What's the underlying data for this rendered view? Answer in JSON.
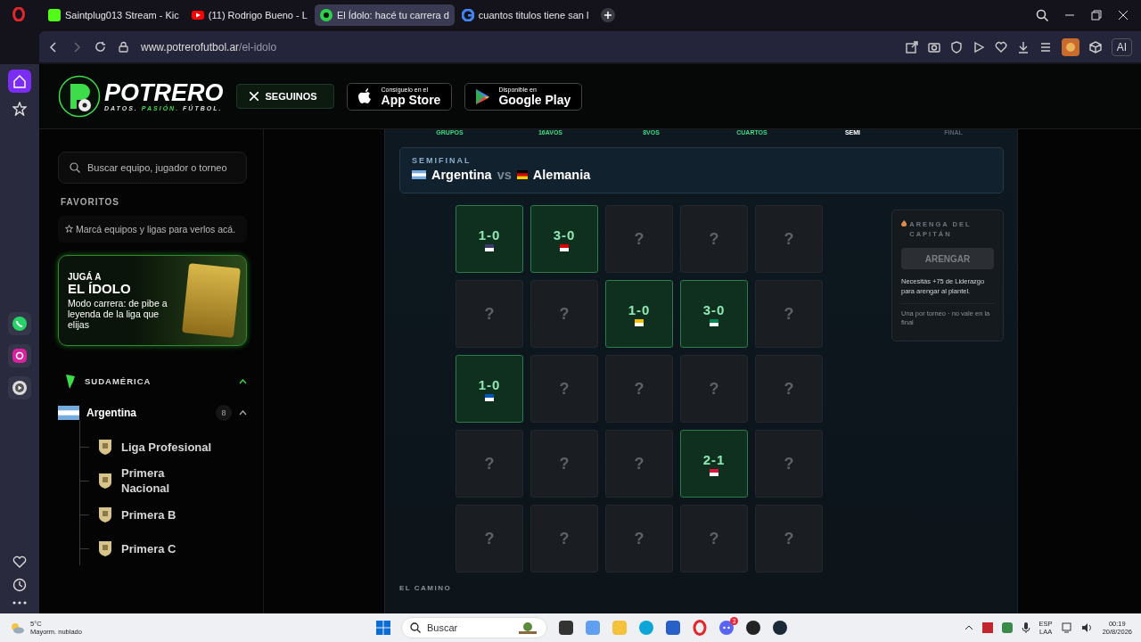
{
  "browser": {
    "tabs": [
      {
        "title": "Saintplug013 Stream - Kic",
        "selected": false
      },
      {
        "title": "(11) Rodrigo Bueno - L",
        "selected": false
      },
      {
        "title": "El Ídolo: hacé tu carrera d",
        "selected": true
      },
      {
        "title": "cuantos titulos tiene san l",
        "selected": false
      }
    ],
    "url_host": "www.potrerofutbol.ar",
    "url_path": "/el-idolo",
    "ai_label": "AI"
  },
  "header": {
    "logo_name": "POTRERO",
    "tagline": [
      {
        "text": "DATOS.",
        "accent": false
      },
      {
        "text": "PASIÓN.",
        "accent": true
      },
      {
        "text": "FÚTBOL.",
        "accent": false
      }
    ],
    "follow_button": "SEGUINOS",
    "stores": [
      {
        "kind": "apple",
        "small": "Consíguelo en el",
        "big": "App Store"
      },
      {
        "kind": "google",
        "small": "Disponible en",
        "big": "Google Play"
      }
    ]
  },
  "sidebar": {
    "search": {
      "placeholder": "Buscar equipo, jugador o torneo"
    },
    "favorites_title": "FAVORITOS",
    "favorites_hint": "Marcá equipos y ligas para verlos acá.",
    "promo": {
      "kicker": "JUGÁ A",
      "title": "EL ÍDOLO",
      "text": "Modo carrera: de pibe a leyenda de la liga que elijas"
    },
    "region": {
      "name": "SUDAMÉRICA",
      "expanded": true,
      "countries": [
        {
          "name": "Argentina",
          "count": "8",
          "expanded": true,
          "leagues": [
            {
              "name": "Liga Profesional"
            },
            {
              "name": "Primera Nacional"
            },
            {
              "name": "Primera B"
            },
            {
              "name": "Primera C"
            }
          ]
        }
      ]
    }
  },
  "game": {
    "stages": [
      {
        "label": "GRUPOS",
        "selected": false,
        "disabled": false
      },
      {
        "label": "16AVOS",
        "selected": false,
        "disabled": false
      },
      {
        "label": "8VOS",
        "selected": false,
        "disabled": false
      },
      {
        "label": "CUARTOS",
        "selected": false,
        "disabled": false
      },
      {
        "label": "SEMI",
        "selected": true,
        "disabled": false
      },
      {
        "label": "FINAL",
        "selected": false,
        "disabled": true
      }
    ],
    "round": "SEMIFINAL",
    "home": "Argentina",
    "vs": "vs",
    "away": "Alemania",
    "grid": [
      {
        "cells": [
          {
            "kind": "result",
            "score": "1-0",
            "color": "#3c3b6e"
          },
          {
            "kind": "result",
            "score": "3-0",
            "color": "#da0000"
          },
          {
            "kind": "unknown",
            "mark": "?"
          },
          {
            "kind": "unknown",
            "mark": "?"
          },
          {
            "kind": "unknown",
            "mark": "?"
          }
        ]
      },
      {
        "cells": [
          {
            "kind": "unknown",
            "mark": "?"
          },
          {
            "kind": "unknown",
            "mark": "?"
          },
          {
            "kind": "result",
            "score": "1-0",
            "color": "#f2c200"
          },
          {
            "kind": "result",
            "score": "3-0",
            "color": "#008751"
          },
          {
            "kind": "unknown",
            "mark": "?"
          }
        ]
      },
      {
        "cells": [
          {
            "kind": "result",
            "score": "1-0",
            "color": "#0057b7"
          },
          {
            "kind": "unknown",
            "mark": "?"
          },
          {
            "kind": "unknown",
            "mark": "?"
          },
          {
            "kind": "unknown",
            "mark": "?"
          },
          {
            "kind": "unknown",
            "mark": "?"
          }
        ]
      },
      {
        "cells": [
          {
            "kind": "unknown",
            "mark": "?"
          },
          {
            "kind": "unknown",
            "mark": "?"
          },
          {
            "kind": "unknown",
            "mark": "?"
          },
          {
            "kind": "result",
            "score": "2-1",
            "color": "#dc143c"
          },
          {
            "kind": "unknown",
            "mark": "?"
          }
        ]
      },
      {
        "cells": [
          {
            "kind": "unknown",
            "mark": "?"
          },
          {
            "kind": "unknown",
            "mark": "?"
          },
          {
            "kind": "unknown",
            "mark": "?"
          },
          {
            "kind": "unknown",
            "mark": "?"
          },
          {
            "kind": "unknown",
            "mark": "?"
          }
        ]
      }
    ],
    "captain": {
      "title": "ARENGA DEL CAPITÁN",
      "button": "ARENGAR",
      "disabled": true,
      "note": "Necesitás +75 de Liderazgo para arengar al plantel.",
      "fine_print": "Una por torneo · no vale en la final"
    },
    "path_title": "EL CAMINO"
  },
  "taskbar": {
    "temperature": "5°C",
    "weather": "Mayorm. nublado",
    "search_placeholder": "Buscar",
    "chat_badge": "3",
    "lang": "ESP",
    "layout": "LAA",
    "time": "00:19",
    "date": "20/8/2026"
  }
}
